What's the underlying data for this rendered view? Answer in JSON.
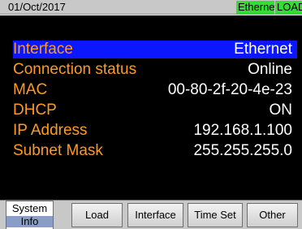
{
  "status_bar": {
    "date": "01/Oct/2017",
    "interface_badge": "Ethernet",
    "mode_badge": "LOAD"
  },
  "interface_info": [
    {
      "label": "Interface",
      "value": "Ethernet"
    },
    {
      "label": "Connection status",
      "value": "Online"
    },
    {
      "label": "MAC",
      "value": "00-80-2f-20-4e-23"
    },
    {
      "label": "DHCP",
      "value": "ON"
    },
    {
      "label": "IP Address",
      "value": "192.168.1.100"
    },
    {
      "label": "Subnet Mask",
      "value": "255.255.255.0"
    }
  ],
  "softkeys": {
    "system_info_line1": "System",
    "system_info_line2": "Info",
    "load": "Load",
    "interface": "Interface",
    "time_set": "Time Set",
    "other": "Other"
  },
  "colors": {
    "label_orange": "#ff9a1f",
    "selected_row_blue": "#0b18ff",
    "badge_green": "#33dd33"
  }
}
